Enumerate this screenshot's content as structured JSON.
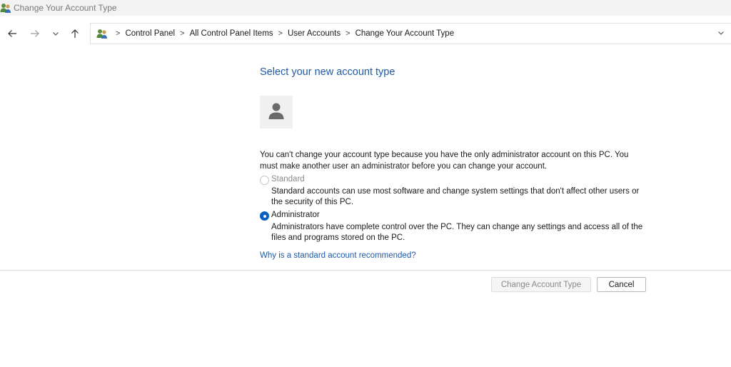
{
  "window": {
    "title": "Change Your Account Type",
    "icon": "user-accounts-icon"
  },
  "nav": {
    "back_icon": "arrow-left-icon",
    "forward_icon": "arrow-right-icon",
    "recent_icon": "chevron-down-icon",
    "up_icon": "arrow-up-icon"
  },
  "address": {
    "icon": "user-accounts-icon",
    "separator": ">",
    "crumbs": [
      "Control Panel",
      "All Control Panel Items",
      "User Accounts",
      "Change Your Account Type"
    ]
  },
  "main": {
    "heading": "Select your new account type",
    "account_name": "",
    "notice": "You can't change your account type because you have the only administrator account on this PC. You must make another user an administrator before you can change your account.",
    "options": [
      {
        "label": "Standard",
        "description": "Standard accounts can use most software and change system settings that don't affect other users or the security of this PC.",
        "selected": false,
        "enabled": false
      },
      {
        "label": "Administrator",
        "description": "Administrators have complete control over the PC. They can change any settings and access all of the files and programs stored on the PC.",
        "selected": true,
        "enabled": true
      }
    ],
    "help_link": "Why is a standard account recommended?"
  },
  "buttons": {
    "change": "Change Account Type",
    "cancel": "Cancel"
  },
  "colors": {
    "link": "#1e5aa8",
    "accent": "#0a5fc4",
    "disabled_text": "#8a8a8a"
  }
}
